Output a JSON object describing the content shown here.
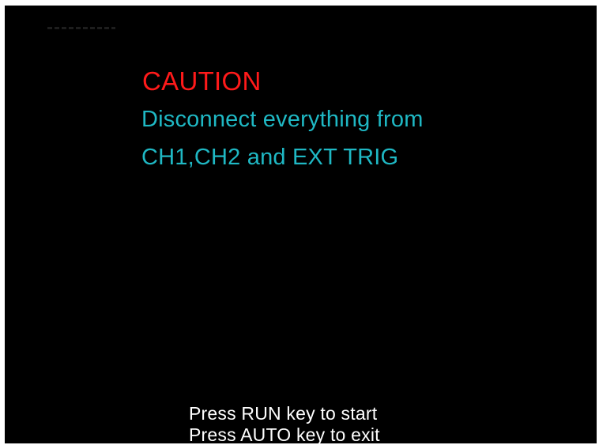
{
  "screen": {
    "background_color": "#000000",
    "caution": {
      "title": "CAUTION",
      "title_color": "#ff1a1a",
      "message_lines": [
        "Disconnect everything from",
        "CH1,CH2 and EXT TRIG"
      ],
      "message_color": "#1fb8c4"
    },
    "instructions": [
      "Press RUN key to start",
      "Press AUTO key to exit"
    ],
    "instruction_color": "#ffffff"
  }
}
